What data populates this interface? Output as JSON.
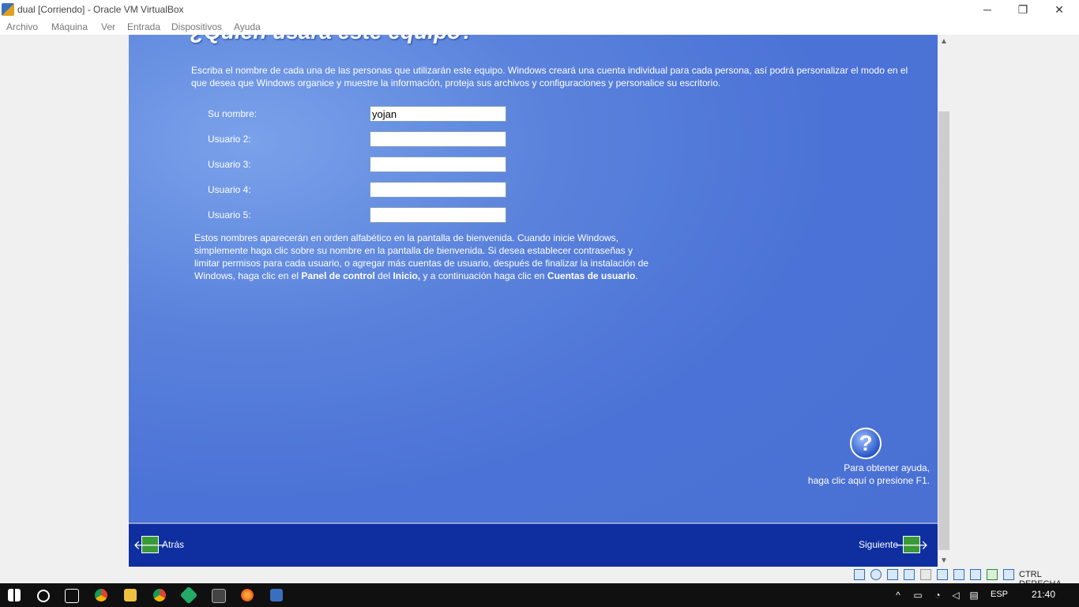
{
  "window": {
    "title": "dual [Corriendo] - Oracle VM VirtualBox",
    "minimize_glyph": "─",
    "restore_glyph": "❐",
    "close_glyph": "✕"
  },
  "menubar": {
    "items": [
      "Archivo",
      "Máquina",
      "Ver",
      "Entrada",
      "Dispositivos",
      "Ayuda"
    ]
  },
  "guest": {
    "heading": "¿Quién usará este equipo?",
    "intro": "Escriba el nombre de cada una de las personas que utilizarán este equipo. Windows creará una cuenta individual para cada persona, así podrá personalizar el modo en el que desea que Windows organice y muestre la información, proteja sus archivos y configuraciones y personalice su escritorio.",
    "fields": [
      {
        "label": "Su nombre:",
        "value": "yojan"
      },
      {
        "label": "Usuario 2:",
        "value": ""
      },
      {
        "label": "Usuario 3:",
        "value": ""
      },
      {
        "label": "Usuario 4:",
        "value": ""
      },
      {
        "label": "Usuario 5:",
        "value": ""
      }
    ],
    "info": {
      "part1": "Estos nombres aparecerán en orden alfabético en la pantalla de bienvenida. Cuando inicie Windows, simplemente haga clic sobre su nombre en la pantalla de bienvenida. Si desea establecer contraseñas y limitar permisos para cada usuario, o agregar más cuentas de usuario, después de finalizar la instalación de Windows, haga clic en el ",
      "bold1": "Panel de control",
      "part2": " del ",
      "bold2": "Inicio,",
      "part3": " y a continuación haga clic en ",
      "bold3": "Cuentas de usuario",
      "part4": "."
    },
    "help_icon": "?",
    "help_line1": "Para obtener ayuda,",
    "help_line2": "haga clic aquí o presione F1.",
    "back_label": "Atrás",
    "back_arrow": "🡐",
    "next_label": "Siguiente",
    "next_arrow": "🡒"
  },
  "scrollbar": {
    "up": "▲",
    "down": "▼"
  },
  "statusbar": {
    "host_key": "CTRL DERECHA",
    "icons": [
      "hard-disk-icon",
      "optical-drive-icon",
      "audio-icon",
      "network-icon",
      "usb-icon",
      "shared-folders-icon",
      "display-icon",
      "video-capture-icon",
      "cpu-icon",
      "mouse-integration-icon",
      "keyboard-icon"
    ]
  },
  "taskbar": {
    "language": "ESP",
    "time": "21:40",
    "icons": [
      "windows-start-icon",
      "cortana-search-icon",
      "task-view-icon",
      "chrome-icon",
      "file-explorer-icon",
      "chrome-icon",
      "git-icon",
      "terminal-icon",
      "firefox-icon",
      "virtualbox-icon"
    ]
  }
}
